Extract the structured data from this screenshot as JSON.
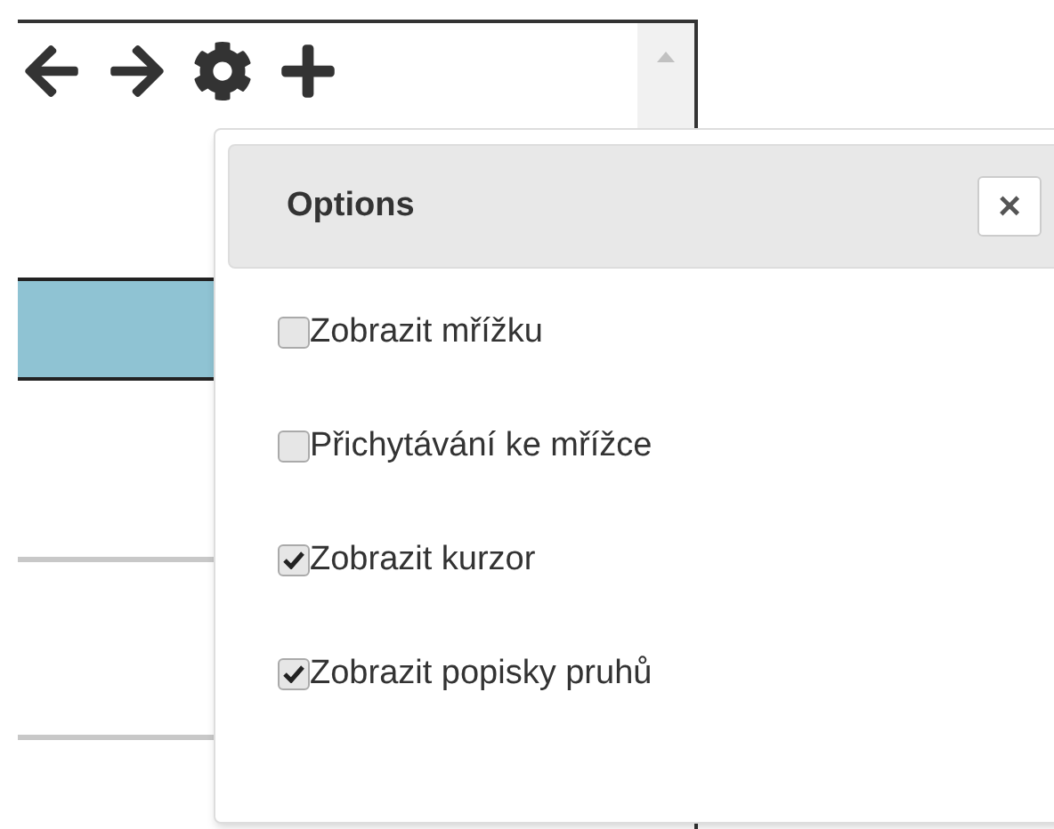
{
  "dialog": {
    "title": "Options",
    "close_label": "×"
  },
  "options": [
    {
      "label": "Zobrazit mřížku",
      "checked": false
    },
    {
      "label": "Přichytávání ke mřížce",
      "checked": false
    },
    {
      "label": "Zobrazit kurzor",
      "checked": true
    },
    {
      "label": "Zobrazit popisky pruhů",
      "checked": true
    }
  ]
}
